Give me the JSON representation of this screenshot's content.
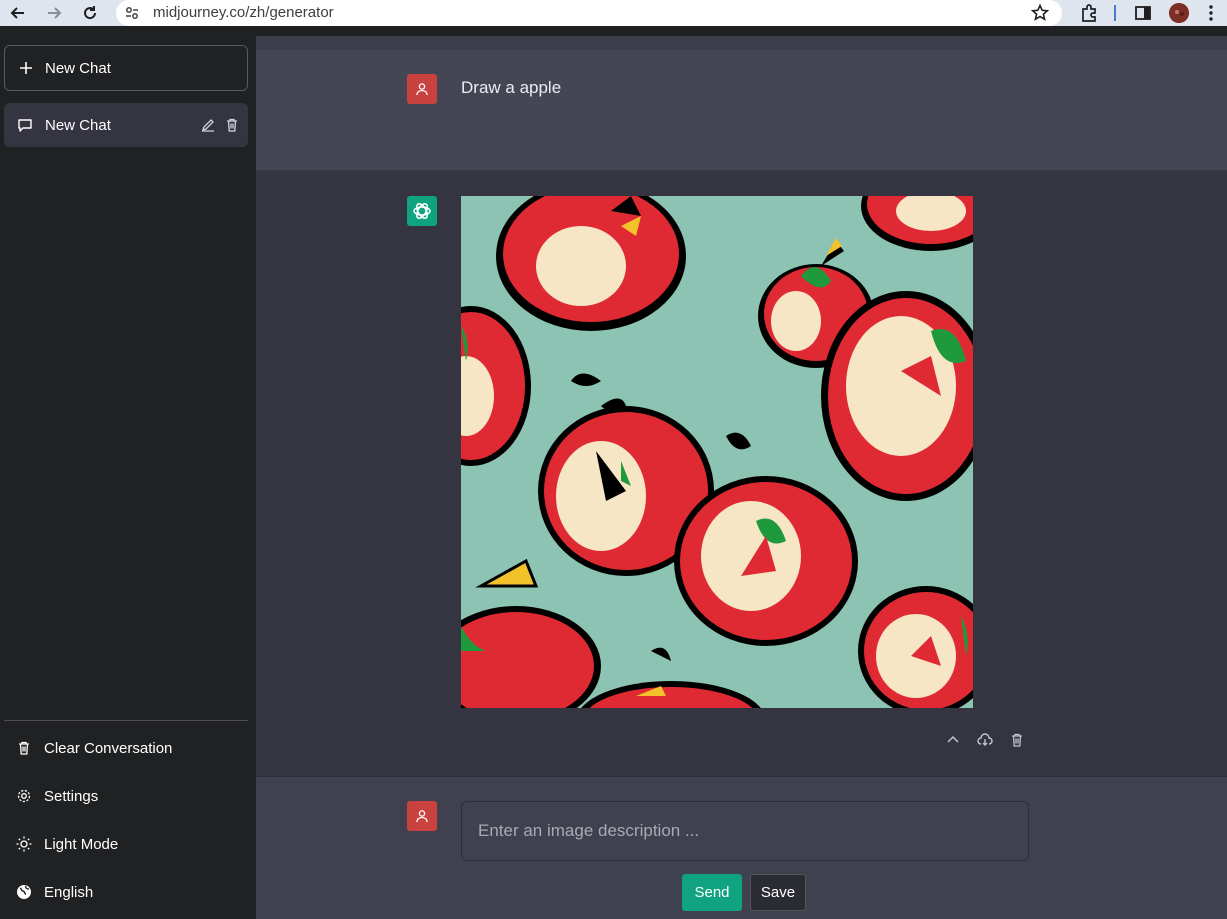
{
  "browser": {
    "url": "midjourney.co/zh/generator",
    "icons": [
      "back-arrow-icon",
      "forward-arrow-icon",
      "reload-icon",
      "site-settings-icon",
      "bookmark-star-icon",
      "extensions-icon",
      "side-panel-icon",
      "profile-avatar",
      "kebab-menu-icon"
    ]
  },
  "sidebar": {
    "new_chat_label": "New Chat",
    "chats": [
      {
        "label": "New Chat",
        "selected": true
      }
    ],
    "actions": {
      "clear": "Clear Conversation",
      "settings": "Settings",
      "light_mode": "Light Mode",
      "language": "English"
    }
  },
  "conversation": {
    "user_message": "Draw a apple",
    "assistant_content": "image",
    "image_actions": [
      "chevron-up-icon",
      "cloud-download-icon",
      "trash-icon"
    ]
  },
  "composer": {
    "placeholder": "Enter an image description ...",
    "value": "",
    "send_label": "Send",
    "save_label": "Save"
  },
  "colors": {
    "sidebar_bg": "#202123",
    "main_bg": "#343541",
    "user_row_bg": "#444654",
    "accent_green": "#10a37f",
    "user_avatar_red": "#c9423f",
    "image_background": "#8cc3b2",
    "apple_red": "#e02a33"
  }
}
